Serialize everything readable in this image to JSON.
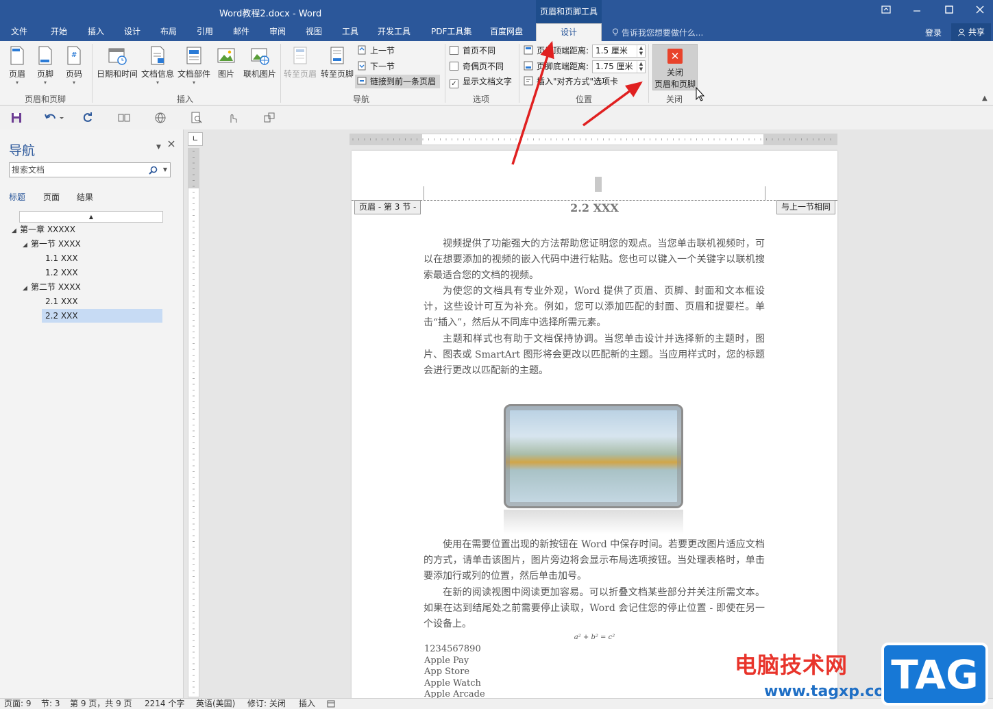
{
  "window": {
    "title": "Word教程2.docx  -  Word",
    "context_tool": "页眉和页脚工具"
  },
  "tabs": [
    "文件",
    "开始",
    "插入",
    "设计",
    "布局",
    "引用",
    "邮件",
    "审阅",
    "视图",
    "工具",
    "开发工具",
    "PDF工具集",
    "百度网盘"
  ],
  "active_tab": "设计",
  "tell_me": "告诉我您想要做什么...",
  "login": "登录",
  "share": "共享",
  "ribbon": {
    "groups": {
      "header_footer": "页眉和页脚",
      "insert": "插入",
      "navigation": "导航",
      "options": "选项",
      "position": "位置",
      "close": "关闭"
    },
    "header_btn": "页眉",
    "footer_btn": "页脚",
    "pagenum_btn": "页码",
    "datetime_btn": "日期和时间",
    "docinfo_btn": "文档信息",
    "docparts_btn": "文档部件",
    "picture_btn": "图片",
    "online_picture_btn": "联机图片",
    "goto_header_btn": "转至页眉",
    "goto_footer_btn": "转至页脚",
    "prev_section": "上一节",
    "next_section": "下一节",
    "link_previous": "链接到前一条页眉",
    "diff_first": "首页不同",
    "diff_odd_even": "奇偶页不同",
    "show_doc_text": "显示文档文字",
    "header_top_label": "页眉顶端距离:",
    "header_top_value": "1.5 厘米",
    "footer_bottom_label": "页脚底端距离:",
    "footer_bottom_value": "1.75 厘米",
    "insert_align_tab": "插入\"对齐方式\"选项卡",
    "close_btn_line1": "关闭",
    "close_btn_line2": "页眉和页脚"
  },
  "nav": {
    "title": "导航",
    "search_placeholder": "搜索文档",
    "tabs": [
      "标题",
      "页面",
      "结果"
    ],
    "tree": [
      {
        "label": "第一章 XXXXX",
        "level": 0,
        "expanded": true
      },
      {
        "label": "第一节 XXXX",
        "level": 1,
        "expanded": true
      },
      {
        "label": "1.1 XXX",
        "level": 2
      },
      {
        "label": "1.2 XXX",
        "level": 2
      },
      {
        "label": "第二节 XXXX",
        "level": 1,
        "expanded": true
      },
      {
        "label": "2.1 XXX",
        "level": 2
      },
      {
        "label": "2.2 XXX",
        "level": 2,
        "selected": true
      }
    ]
  },
  "document": {
    "header_section_tag": "页眉 - 第 3 节 -",
    "header_same_tag": "与上一节相同",
    "header_title": "2.2 XXX",
    "paragraphs1": [
      "视频提供了功能强大的方法帮助您证明您的观点。当您单击联机视频时，可以在想要添加的视频的嵌入代码中进行粘贴。您也可以键入一个关键字以联机搜索最适合您的文档的视频。",
      "为使您的文档具有专业外观，Word 提供了页眉、页脚、封面和文本框设计，这些设计可互为补充。例如，您可以添加匹配的封面、页眉和提要栏。单击“插入”，然后从不同库中选择所需元素。",
      "主题和样式也有助于文档保持协调。当您单击设计并选择新的主题时，图片、图表或 SmartArt 图形将会更改以匹配新的主题。当应用样式时，您的标题会进行更改以匹配新的主题。"
    ],
    "paragraphs2": [
      "使用在需要位置出现的新按钮在 Word 中保存时间。若要更改图片适应文档的方式，请单击该图片，图片旁边将会显示布局选项按钮。当处理表格时，单击要添加行或列的位置，然后单击加号。",
      "在新的阅读视图中阅读更加容易。可以折叠文档某些部分并关注所需文本。如果在达到结尾处之前需要停止读取，Word 会记住您的停止位置 - 即使在另一个设备上。"
    ],
    "formula": "a² + b² = c²",
    "list": [
      "1234567890",
      "Apple Pay",
      "App Store",
      "Apple Watch",
      "Apple Arcade"
    ]
  },
  "status": {
    "page": "页面: 9",
    "section": "节: 3",
    "page_of": "第 9 页，共 9 页",
    "words": "2214 个字",
    "language": "英语(美国)",
    "track": "修订: 关闭",
    "mode": "插入"
  },
  "watermark": {
    "text": "电脑技术网",
    "url": "www.tagxp.com",
    "tag": "TAG"
  },
  "colors": {
    "brand": "#2b579a",
    "arrow": "#e02020",
    "close_icon": "#e8432b"
  }
}
